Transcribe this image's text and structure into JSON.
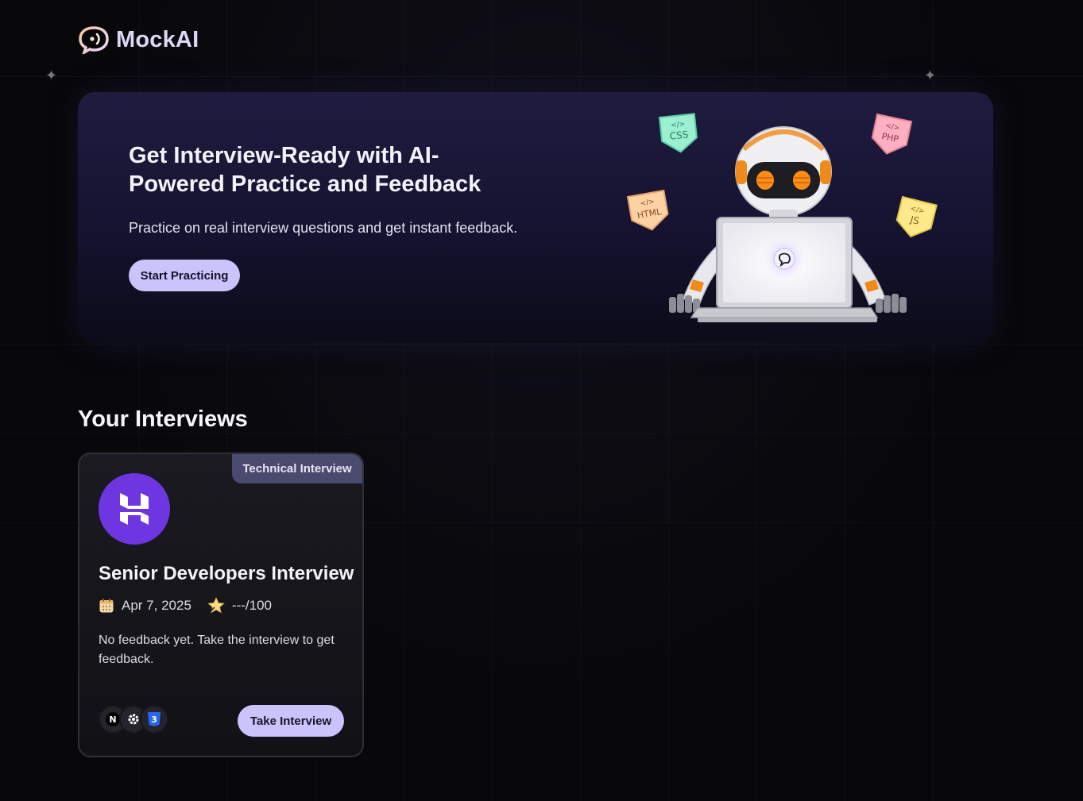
{
  "brand": {
    "name": "MockAI",
    "accent": "#cbc3fb"
  },
  "hero": {
    "title": "Get Interview-Ready with AI-Powered Practice and Feedback",
    "subtitle": "Practice on real interview questions and get instant feedback.",
    "cta_label": "Start Practicing",
    "badges": [
      "CSS",
      "PHP",
      "HTML",
      "JS"
    ]
  },
  "interviews": {
    "heading": "Your Interviews",
    "items": [
      {
        "type": "Technical Interview",
        "title": "Senior Developers Interview",
        "date": "Apr 7, 2025",
        "score": "---/100",
        "feedback": "No feedback yet. Take the interview to get feedback.",
        "tech_icons": [
          "nextjs-icon",
          "gear-icon",
          "css3-icon"
        ],
        "cta_label": "Take Interview",
        "logo_color": "#6d36e0"
      }
    ]
  }
}
